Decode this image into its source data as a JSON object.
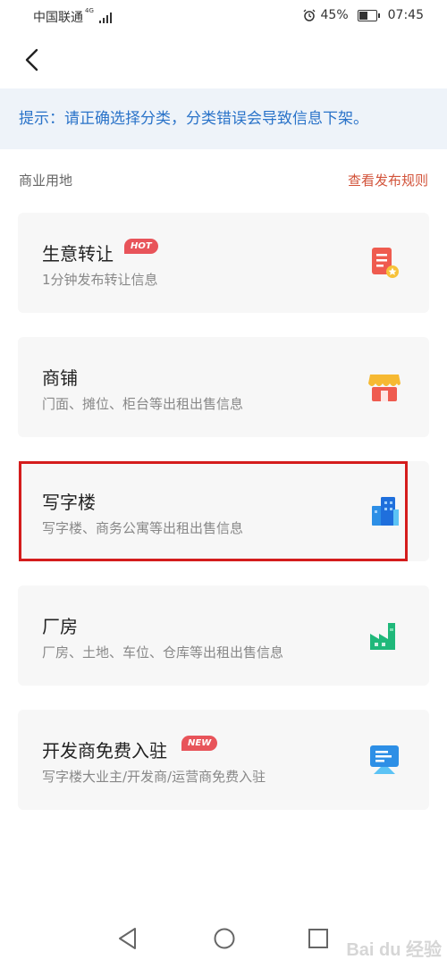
{
  "status_bar": {
    "carrier": "中国联通",
    "network": "4G",
    "battery": "45%",
    "time": "07:45"
  },
  "tip": "提示：请正确选择分类，分类错误会导致信息下架。",
  "section": {
    "title": "商业用地",
    "rules_link": "查看发布规则"
  },
  "cards": [
    {
      "title": "生意转让",
      "badge": "HOT",
      "desc": "1分钟发布转让信息",
      "icon": "transfer-doc-icon"
    },
    {
      "title": "商铺",
      "badge": "",
      "desc": "门面、摊位、柜台等出租出售信息",
      "icon": "shop-awning-icon"
    },
    {
      "title": "写字楼",
      "badge": "",
      "desc": "写字楼、商务公寓等出租出售信息",
      "icon": "office-building-icon"
    },
    {
      "title": "厂房",
      "badge": "",
      "desc": "厂房、土地、车位、仓库等出租出售信息",
      "icon": "factory-icon"
    },
    {
      "title": "开发商免费入驻",
      "badge": "NEW",
      "desc": "写字楼大业主/开发商/运营商免费入驻",
      "icon": "presentation-screen-icon"
    }
  ],
  "watermark": "Bai du 经验",
  "colors": {
    "accent_blue": "#2a73c9",
    "link_red": "#d2533a",
    "highlight_red": "#d41c1c",
    "badge_red": "#e8545a"
  }
}
